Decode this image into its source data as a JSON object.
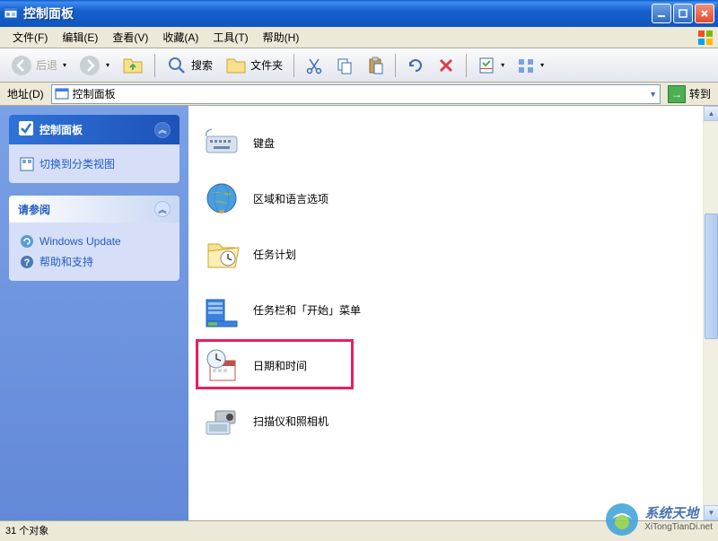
{
  "window": {
    "title": "控制面板"
  },
  "menu": {
    "file": "文件(F)",
    "edit": "编辑(E)",
    "view": "查看(V)",
    "favorites": "收藏(A)",
    "tools": "工具(T)",
    "help": "帮助(H)"
  },
  "toolbar": {
    "back": "后退",
    "search": "搜索",
    "folders": "文件夹"
  },
  "address": {
    "label": "地址(D)",
    "value": "控制面板",
    "go": "转到"
  },
  "sidebar": {
    "panel1": {
      "title": "控制面板",
      "link1": "切换到分类视图"
    },
    "panel2": {
      "title": "请参阅",
      "link1": "Windows Update",
      "link2": "帮助和支持"
    }
  },
  "items": [
    {
      "label": "键盘"
    },
    {
      "label": "区域和语言选项"
    },
    {
      "label": "任务计划"
    },
    {
      "label": "任务栏和「开始」菜单"
    },
    {
      "label": "日期和时间",
      "highlighted": true
    },
    {
      "label": "扫描仪和照相机"
    }
  ],
  "statusbar": {
    "text": "31 个对象"
  },
  "watermark": {
    "cn": "系统天地",
    "url": "XiTongTianDi.net"
  }
}
